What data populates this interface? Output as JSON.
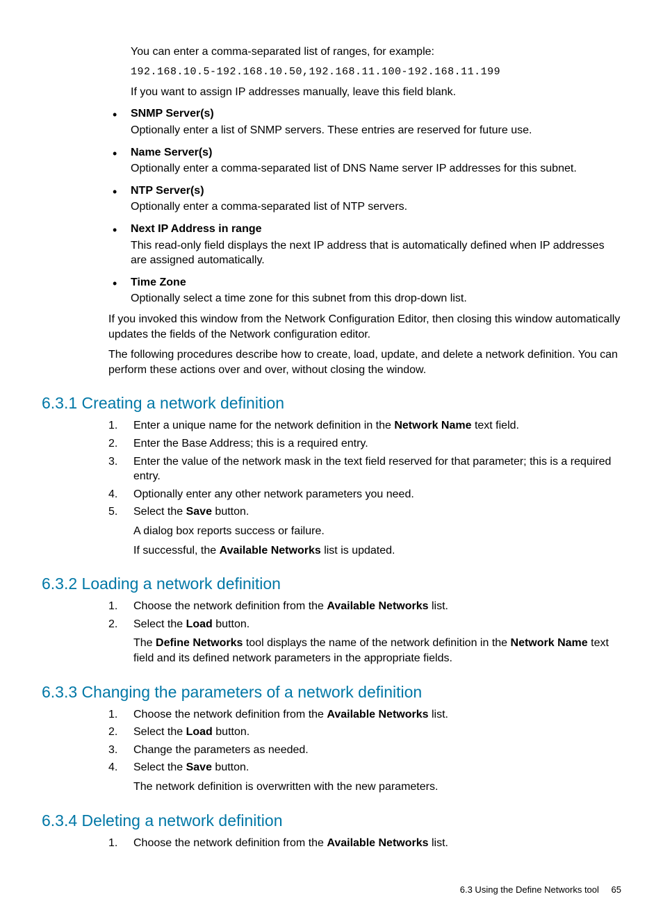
{
  "intro": {
    "p1": "You can enter a comma-separated list of ranges, for example:",
    "code": "192.168.10.5-192.168.10.50,192.168.11.100-192.168.11.199",
    "p2": "If you want to assign IP addresses manually, leave this field blank."
  },
  "bullets": [
    {
      "term": "SNMP Server(s)",
      "desc": "Optionally enter a list of SNMP servers. These entries are reserved for future use."
    },
    {
      "term": "Name Server(s)",
      "desc": "Optionally enter a comma-separated list of DNS Name server IP addresses for this subnet."
    },
    {
      "term": "NTP Server(s)",
      "desc": "Optionally enter a comma-separated list of NTP servers."
    },
    {
      "term": "Next IP Address in range",
      "desc": "This read-only field displays the next IP address that is automatically defined when IP addresses are assigned automatically."
    },
    {
      "term": "Time Zone",
      "desc": "Optionally select a time zone for this subnet from this drop-down list."
    }
  ],
  "after": {
    "p1": "If you invoked this window from the Network Configuration Editor, then closing this window automatically updates the fields of the Network configuration editor.",
    "p2": "The following procedures describe how to create, load, update, and delete a network definition. You can perform these actions over and over, without closing the window."
  },
  "s631": {
    "title": "6.3.1 Creating a network definition",
    "steps": {
      "s1a": "Enter a unique name for the network definition in the ",
      "s1b": "Network Name",
      "s1c": " text field.",
      "s2": "Enter the Base Address; this is a required entry.",
      "s3": "Enter the value of the network mask in the text field reserved for that parameter; this is a required entry.",
      "s4": "Optionally enter any other network parameters you need.",
      "s5a": "Select the ",
      "s5b": "Save",
      "s5c": " button.",
      "s5d": "A dialog box reports success or failure.",
      "s5e": "If successful, the ",
      "s5f": "Available Networks",
      "s5g": " list is updated."
    }
  },
  "s632": {
    "title": "6.3.2 Loading a network definition",
    "steps": {
      "s1a": "Choose the network definition from the ",
      "s1b": "Available Networks",
      "s1c": " list.",
      "s2a": "Select the ",
      "s2b": "Load",
      "s2c": " button.",
      "s2d": "The ",
      "s2e": "Define Networks",
      "s2f": " tool displays the name of the network definition in the ",
      "s2g": "Network Name",
      "s2h": " text field and its defined network parameters in the appropriate fields."
    }
  },
  "s633": {
    "title": "6.3.3 Changing the parameters of a network definition",
    "steps": {
      "s1a": "Choose the network definition from the ",
      "s1b": "Available Networks",
      "s1c": " list.",
      "s2a": "Select the ",
      "s2b": "Load",
      "s2c": " button.",
      "s3": "Change the parameters as needed.",
      "s4a": "Select the ",
      "s4b": "Save",
      "s4c": " button.",
      "s4d": "The network definition is overwritten with the new parameters."
    }
  },
  "s634": {
    "title": "6.3.4 Deleting a network definition",
    "steps": {
      "s1a": "Choose the network definition from the ",
      "s1b": "Available Networks",
      "s1c": " list."
    }
  },
  "footer": {
    "text": "6.3 Using the Define Networks tool",
    "page": "65"
  }
}
